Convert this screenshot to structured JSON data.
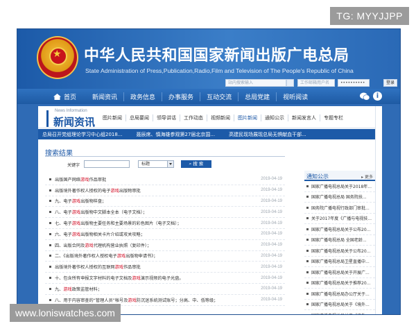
{
  "watermarks": {
    "top": "TG: MYYJJPP",
    "bottom": "www.loniswatches.com"
  },
  "header": {
    "title": "中华人民共和国国家新闻出版广电总局",
    "subtitle": "State Administration of Press,Publication,Radio,Film and Television of The People's Republic of China",
    "site_search_placeholder": "站内搜索输入",
    "username_placeholder": "工作邮箱用户名",
    "password_placeholder": "••••••••••",
    "login_label": "登录"
  },
  "nav": {
    "home": "首页",
    "items": [
      "新闻资讯",
      "政务信息",
      "办事服务",
      "互动交流",
      "总局党建",
      "视听阅读"
    ]
  },
  "section": {
    "title_en": "News Information",
    "title": "新闻资讯",
    "tabs": [
      "图片新闻",
      "总局要闻",
      "领导讲话",
      "工作动态",
      "视频新闻",
      "图片新闻",
      "通知公示",
      "新闻发言人",
      "专题专栏"
    ],
    "active_tab_index": 5
  },
  "ticker": [
    "总局召开党组理论学习中心组2018...",
    "聂辰席、慎海雄参观第27届北京国...",
    "高建民现场展现总局无惧献血干部..."
  ],
  "results": {
    "title": "搜索结果",
    "keyword_label": "关键字",
    "keyword_value": "",
    "select_value": "标题",
    "search_button": "搜 索",
    "rows": [
      {
        "pre": "出版国产网络",
        "hl": "游戏",
        "post": "作品审批",
        "date": "2019-04-19"
      },
      {
        "pre": "出版境外著作权人授权的电子",
        "hl": "游戏",
        "post": "出版物审批",
        "date": "2019-04-19"
      },
      {
        "pre": "九、电子",
        "hl": "游戏",
        "post": "出版物样盘；",
        "date": "2019-04-19"
      },
      {
        "pre": "八、电子",
        "hl": "游戏",
        "post": "出版物中文脚本全本（电子文档）；",
        "date": "2019-04-19"
      },
      {
        "pre": "七、电子",
        "hl": "游戏",
        "post": "出版物主要任务和主要场景的彩色图片（电子文档）；",
        "date": "2019-04-19"
      },
      {
        "pre": "六、电子",
        "hl": "游戏",
        "post": "出版物相关卡片介绍或攻关攻略；",
        "date": "2019-04-19"
      },
      {
        "pre": "四、出版合同及",
        "hl": "游戏",
        "post": "代理机构营业执照（复印件）；",
        "date": "2019-04-19"
      },
      {
        "pre": "二、《出版境外著作权人授权电子",
        "hl": "游戏",
        "post": "出版物申请书》；",
        "date": "2019-04-19"
      },
      {
        "pre": "出版境外著作权人授权的互联网",
        "hl": "游戏",
        "post": "作品审批",
        "date": "2019-04-19"
      },
      {
        "pre": "十、包含所有申报文字材料的电子文档及",
        "hl": "游戏",
        "post": "演示视频的电子光盘。",
        "date": "2019-04-19"
      },
      {
        "pre": "九、",
        "hl": "游戏",
        "post": "政策监管材料；",
        "date": "2019-04-19"
      },
      {
        "pre": "八、用于内容审查的“管理人员”帐号及",
        "hl": "游戏",
        "post": "防沉迷系统测试账号；分高、中、低等级；",
        "date": "2019-04-19"
      }
    ]
  },
  "notice": {
    "title": "通知公示",
    "more": "更多",
    "items": [
      "国家广播电视总局关于2018年...",
      "国家广播电视总局 国务院扶...",
      "国务院广播电视行政部门审批...",
      "关于2017年度《广播与电视技...",
      "国家广播电视总局关于公布20...",
      "国家广播电视总局 全国老龄...",
      "国家广播电视总局关于公布20...",
      "国家广播电视总局卫星直播中...",
      "国家广播电视总局关于开展广...",
      "国家广播电视总局关于推荐20...",
      "国家广播电视总局办公厅关于...",
      "国家广播电视总局关于《境外...",
      "国家广播电视总局关于《境外..."
    ]
  },
  "colors": {
    "brand_blue": "#1c5aa8",
    "highlight_red": "#d0021b"
  }
}
